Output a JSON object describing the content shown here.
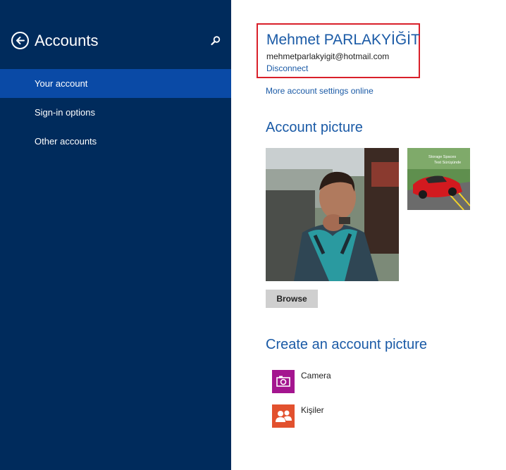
{
  "sidebar": {
    "title": "Accounts",
    "nav_items": [
      {
        "label": "Your account",
        "selected": true
      },
      {
        "label": "Sign-in options",
        "selected": false
      },
      {
        "label": "Other accounts",
        "selected": false
      }
    ],
    "background_color": "#002b5c",
    "selected_color": "#0a4aa6"
  },
  "account": {
    "name": "Mehmet PARLAKYİĞİT",
    "email": "mehmetparlakyigit@hotmail.com",
    "disconnect_label": "Disconnect",
    "more_settings_label": "More account settings online"
  },
  "account_picture": {
    "title": "Account picture",
    "small_picture_caption_line1": "Storage Spaces",
    "small_picture_caption_line2": "Test Sürüşünde",
    "browse_label": "Browse"
  },
  "create_picture": {
    "title": "Create an account picture",
    "apps": [
      {
        "label": "Camera",
        "icon": "camera-icon",
        "color": "#a4158f"
      },
      {
        "label": "Kişiler",
        "icon": "people-icon",
        "color": "#e2512e"
      }
    ]
  },
  "colors": {
    "accent": "#1a5aa6",
    "highlight_box": "#d9202a"
  }
}
